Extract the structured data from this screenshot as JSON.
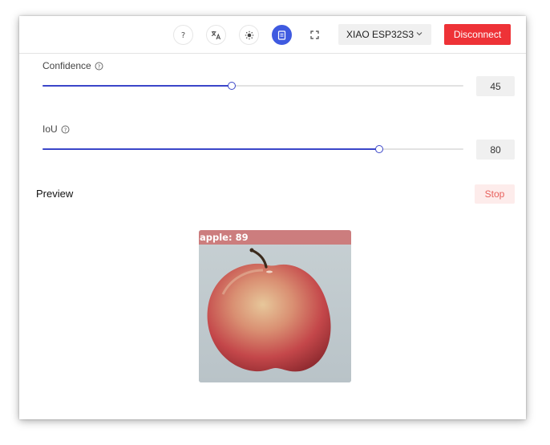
{
  "header": {
    "icons": [
      "help-icon",
      "translate-icon",
      "theme-icon",
      "document-icon",
      "fullscreen-icon"
    ],
    "active_icon": "document-icon",
    "device": {
      "selected": "XIAO ESP32S3"
    },
    "disconnect_label": "Disconnect"
  },
  "settings": {
    "confidence": {
      "label": "Confidence",
      "value": "45",
      "fraction": 0.45
    },
    "iou": {
      "label": "IoU",
      "value": "80",
      "fraction": 0.8
    }
  },
  "preview": {
    "title": "Preview",
    "stop_label": "Stop",
    "detection": {
      "label": "apple: 89"
    }
  },
  "colors": {
    "accent": "#3f5ae0",
    "slider": "#3b46c9",
    "danger": "#ee3237",
    "stop_bg": "#fdeceb",
    "stop_text": "#e8605c",
    "box_label_bg": "#cd6e6e"
  }
}
